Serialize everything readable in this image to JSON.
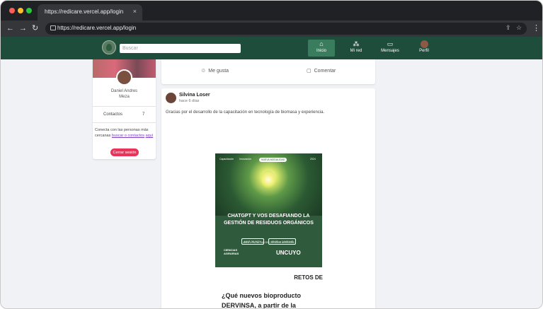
{
  "browser": {
    "tab_title": "https://redicare.vercel.app/login",
    "tab_close": "×",
    "url": "https://redicare.vercel.app/login"
  },
  "header": {
    "search_placeholder": "Buscar",
    "nav": [
      {
        "label": "Inicio",
        "icon": "home-icon",
        "active": true
      },
      {
        "label": "Mi red",
        "icon": "network-icon",
        "active": false
      },
      {
        "label": "Mensajes",
        "icon": "messages-icon",
        "active": false
      },
      {
        "label": "Perfil",
        "icon": "avatar",
        "active": false
      }
    ]
  },
  "profile": {
    "name_line1": "Daniel Andres",
    "name_line2": "Meza",
    "contacts_label": "Contactos",
    "contacts_count": "7",
    "desc_before": "Conecta con las personas más cercanas",
    "desc_link": "buscar o contactos",
    "desc_after": "aquí",
    "logout_label": "Cerrar sesión"
  },
  "previous_post": {
    "like_label": "Me gusta",
    "comment_label": "Comentar"
  },
  "post": {
    "author": "Silvina Loser",
    "time": "hace 6 días",
    "text": "Gracias por el desarrollo de la capacitación en tecnología de biomasa y experiencia.",
    "poster": {
      "pills": [
        "Capacitación",
        "Innovación",
        "NUEVA MODALIDAD",
        "2024"
      ],
      "title_line1": "CHATGPT Y VOS DESAFIANDO LA",
      "title_line2": "GESTIÓN DE RESIDUOS ORGÁNICOS",
      "date_box": "MAR 26 NOV",
      "time_box": "09:00 a 14:00 HS",
      "place": "AULA 4 FACULTAD DE CIENCIAS AGRARIAS",
      "logo_left_line1": "CIENCIAS",
      "logo_left_line2": "AGRARIAS",
      "logo_right": "UNCUYO"
    },
    "retos": "RETOS DE",
    "question_line1": "¿Qué nuevos bioproducto",
    "question_line2": "DERVINSA, a partir de la"
  },
  "colors": {
    "header_bg": "#1e4d3c",
    "nav_active": "#3a7d5e",
    "logout_bg": "#e8345b",
    "page_bg": "#f0f2f5"
  }
}
